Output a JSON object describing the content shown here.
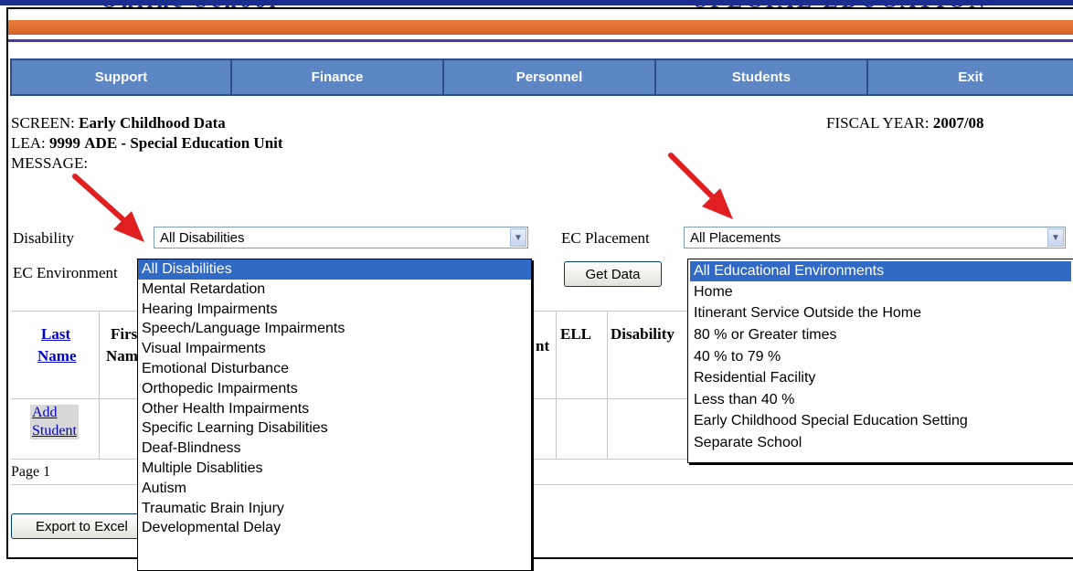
{
  "banner": {
    "left_text": "Online School",
    "right_text": "SPECIAL EDUCATION"
  },
  "nav": {
    "items": [
      {
        "label": "Support"
      },
      {
        "label": "Finance"
      },
      {
        "label": "Personnel"
      },
      {
        "label": "Students"
      },
      {
        "label": "Exit"
      }
    ]
  },
  "header": {
    "screen_label": "SCREEN:",
    "screen_value": "Early Childhood Data",
    "fiscal_label": "FISCAL YEAR:",
    "fiscal_value": "2007/08",
    "lea_label": "LEA:",
    "lea_code": "9999",
    "lea_name": "ADE - Special Education Unit",
    "message_label": "MESSAGE:"
  },
  "filters": {
    "disability_label": "Disability",
    "disability_value": "All Disabilities",
    "placement_label": "EC Placement",
    "placement_value": "All Placements",
    "environment_label": "EC Environment",
    "get_data_label": "Get Data"
  },
  "disability_options": [
    "All Disabilities",
    "Mental Retardation",
    "Hearing Impairments",
    "Speech/Language Impairments",
    "Visual Impairments",
    "Emotional Disturbance",
    "Orthopedic Impairments",
    "Other Health Impairments",
    "Specific Learning Disabilities",
    "Deaf-Blindness",
    "Multiple Disablities",
    "Autism",
    "Traumatic Brain Injury",
    "Developmental Delay"
  ],
  "environment_options": [
    "All Educational Environments",
    "Home",
    "Itinerant Service Outside the Home",
    "80 % or Greater times",
    "40 % to 79 %",
    "Residential Facility",
    "Less than 40 %",
    "Early Childhood Special Education Setting",
    "Separate School"
  ],
  "table": {
    "col_last_1": "Last",
    "col_last_2": "Name",
    "col_first_1": "First",
    "col_first_2": "Name",
    "col_ment": "nt",
    "col_ell": "ELL",
    "col_disability": "Disability"
  },
  "add_student": {
    "line1": "Add",
    "line2": "Student"
  },
  "pagination": {
    "label": "Page 1"
  },
  "export_label": "Export to Excel",
  "colors": {
    "nav_bg": "#5d86c5",
    "selected_option": "#316ac5",
    "arrow": "#e02020",
    "banner_orange": "#e97b3a"
  }
}
